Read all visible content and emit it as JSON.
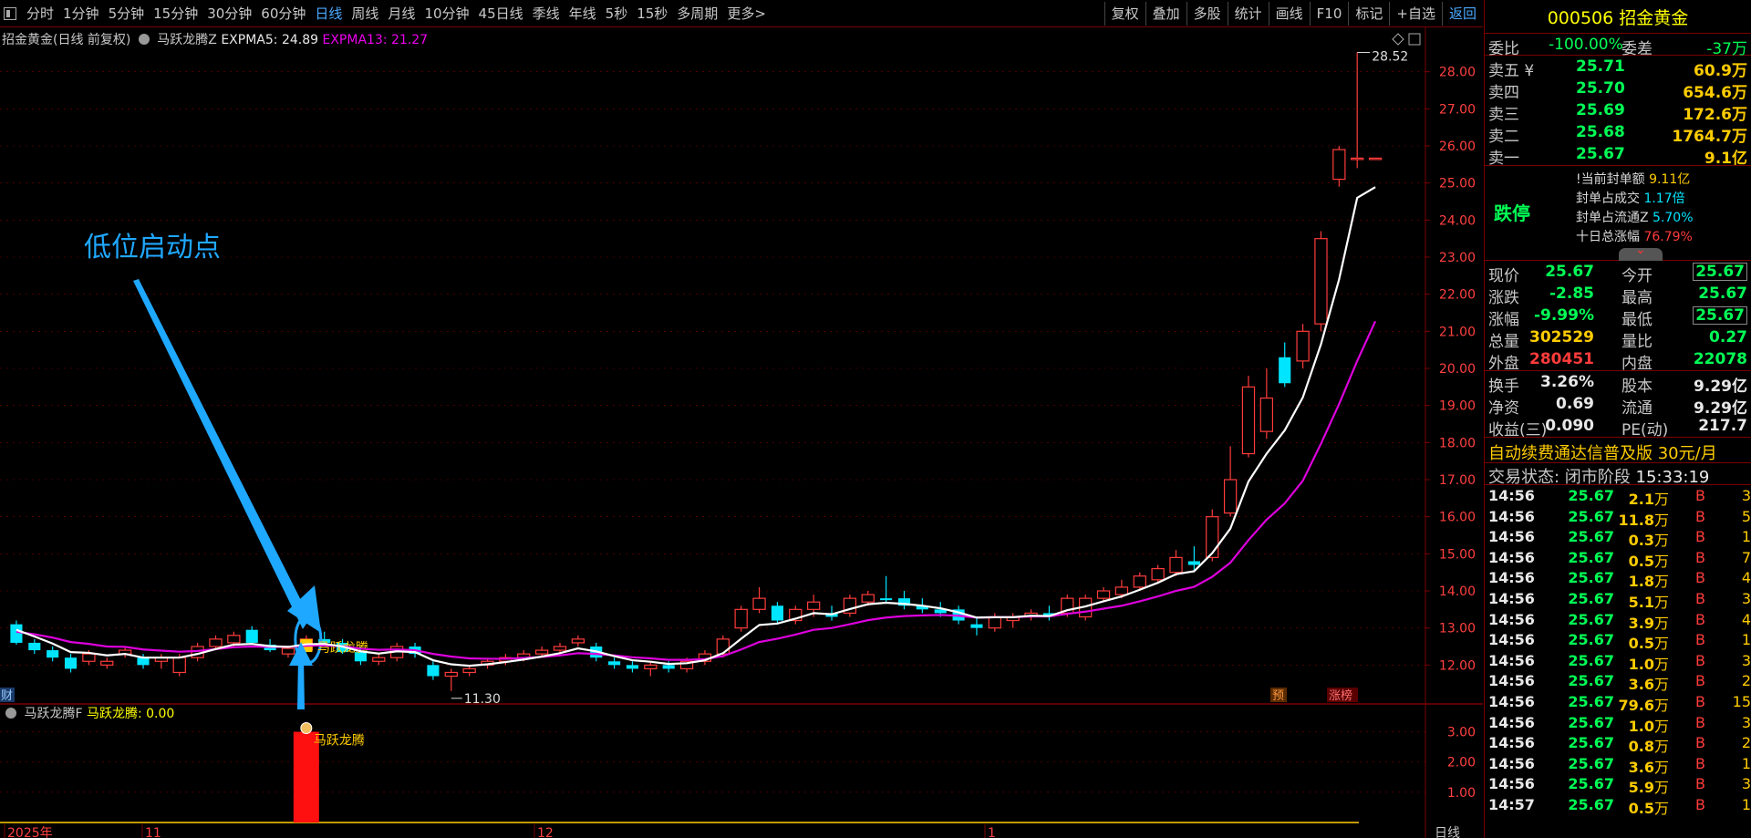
{
  "toolbar": {
    "periods": [
      "分时",
      "1分钟",
      "5分钟",
      "15分钟",
      "30分钟",
      "60分钟",
      "日线",
      "周线",
      "月线",
      "10分钟",
      "45日线",
      "季线",
      "年线",
      "5秒",
      "15秒",
      "多周期",
      "更多>"
    ],
    "active_period": "日线",
    "tools": [
      "复权",
      "叠加",
      "多股",
      "统计",
      "画线",
      "F10",
      "标记",
      "+自选",
      "返回"
    ]
  },
  "chart_header": {
    "stock": "招金黄金(日线 前复权)",
    "indicator": "马跃龙腾Z",
    "expma5": "EXPMA5: 24.89",
    "expma13": "EXPMA13: 21.27"
  },
  "annotation": "低位启动点",
  "chart_data": {
    "type": "candlestick",
    "y_ticks": [
      "28.00",
      "27.00",
      "26.00",
      "25.00",
      "24.00",
      "23.00",
      "22.00",
      "21.00",
      "20.00",
      "19.00",
      "18.00",
      "17.00",
      "16.00",
      "15.00",
      "14.00",
      "13.00",
      "12.00"
    ],
    "ylim": [
      11.0,
      29.0
    ],
    "high_label": "28.52",
    "low_label": "11.30",
    "signal_label": "马跃龙腾",
    "badges": [
      "预",
      "涨榜"
    ],
    "left_badge": "财",
    "x_labels": [
      "2025年",
      "11",
      "12",
      "1"
    ],
    "x_right_label": "日线",
    "ohlc": [
      [
        13.1,
        13.2,
        12.55,
        12.6
      ],
      [
        12.6,
        12.7,
        12.3,
        12.4
      ],
      [
        12.4,
        12.5,
        12.1,
        12.2
      ],
      [
        12.2,
        12.3,
        11.8,
        11.9
      ],
      [
        12.1,
        12.4,
        12.0,
        12.3
      ],
      [
        12.0,
        12.2,
        11.9,
        12.1
      ],
      [
        12.3,
        12.5,
        12.2,
        12.4
      ],
      [
        12.2,
        12.3,
        11.9,
        12.0
      ],
      [
        12.1,
        12.3,
        11.9,
        12.2
      ],
      [
        11.8,
        12.3,
        11.7,
        12.2
      ],
      [
        12.2,
        12.6,
        12.1,
        12.5
      ],
      [
        12.5,
        12.8,
        12.4,
        12.7
      ],
      [
        12.6,
        12.9,
        12.5,
        12.8
      ],
      [
        12.95,
        13.05,
        12.55,
        12.6
      ],
      [
        12.55,
        12.7,
        12.35,
        12.4
      ],
      [
        12.3,
        12.5,
        12.2,
        12.45
      ],
      [
        12.4,
        12.8,
        12.35,
        12.7
      ],
      [
        12.7,
        12.9,
        12.5,
        12.6
      ],
      [
        12.6,
        12.7,
        12.3,
        12.35
      ],
      [
        12.35,
        12.5,
        12.0,
        12.1
      ],
      [
        12.1,
        12.3,
        12.0,
        12.2
      ],
      [
        12.2,
        12.6,
        12.1,
        12.5
      ],
      [
        12.5,
        12.6,
        12.2,
        12.3
      ],
      [
        12.0,
        12.1,
        11.6,
        11.7
      ],
      [
        11.7,
        11.9,
        11.3,
        11.8
      ],
      [
        11.8,
        12.0,
        11.7,
        11.9
      ],
      [
        12.0,
        12.2,
        11.9,
        12.1
      ],
      [
        12.1,
        12.3,
        12.0,
        12.2
      ],
      [
        12.2,
        12.4,
        12.1,
        12.3
      ],
      [
        12.3,
        12.5,
        12.2,
        12.4
      ],
      [
        12.4,
        12.6,
        12.3,
        12.5
      ],
      [
        12.6,
        12.8,
        12.5,
        12.7
      ],
      [
        12.5,
        12.6,
        12.1,
        12.2
      ],
      [
        12.1,
        12.2,
        11.9,
        12.0
      ],
      [
        12.0,
        12.1,
        11.8,
        11.9
      ],
      [
        11.9,
        12.1,
        11.7,
        12.0
      ],
      [
        12.0,
        12.1,
        11.8,
        11.9
      ],
      [
        11.9,
        12.2,
        11.8,
        12.1
      ],
      [
        12.1,
        12.4,
        12.0,
        12.3
      ],
      [
        12.3,
        12.8,
        12.2,
        12.7
      ],
      [
        13.0,
        13.6,
        12.9,
        13.5
      ],
      [
        13.5,
        14.1,
        13.4,
        13.8
      ],
      [
        13.6,
        13.7,
        13.1,
        13.2
      ],
      [
        13.2,
        13.6,
        13.1,
        13.5
      ],
      [
        13.5,
        13.9,
        13.3,
        13.7
      ],
      [
        13.4,
        13.6,
        13.2,
        13.3
      ],
      [
        13.4,
        13.9,
        13.3,
        13.8
      ],
      [
        13.7,
        14.0,
        13.6,
        13.9
      ],
      [
        13.8,
        14.4,
        13.7,
        13.75
      ],
      [
        13.8,
        14.0,
        13.5,
        13.6
      ],
      [
        13.6,
        13.8,
        13.4,
        13.5
      ],
      [
        13.5,
        13.7,
        13.3,
        13.4
      ],
      [
        13.5,
        13.6,
        13.1,
        13.2
      ],
      [
        13.1,
        13.3,
        12.8,
        13.0
      ],
      [
        13.0,
        13.4,
        12.9,
        13.3
      ],
      [
        13.2,
        13.4,
        13.0,
        13.3
      ],
      [
        13.3,
        13.5,
        13.2,
        13.4
      ],
      [
        13.4,
        13.6,
        13.2,
        13.3
      ],
      [
        13.4,
        13.9,
        13.3,
        13.8
      ],
      [
        13.3,
        13.9,
        13.2,
        13.8
      ],
      [
        13.8,
        14.1,
        13.7,
        14.0
      ],
      [
        13.9,
        14.3,
        13.8,
        14.1
      ],
      [
        14.1,
        14.5,
        14.0,
        14.4
      ],
      [
        14.3,
        14.7,
        14.2,
        14.6
      ],
      [
        14.5,
        15.1,
        14.4,
        14.9
      ],
      [
        14.8,
        15.2,
        14.5,
        14.7
      ],
      [
        14.9,
        16.2,
        14.8,
        16.0
      ],
      [
        16.1,
        17.9,
        16.0,
        17.0
      ],
      [
        17.7,
        19.8,
        17.6,
        19.5
      ],
      [
        18.3,
        20.0,
        18.1,
        19.2
      ],
      [
        20.3,
        20.7,
        19.5,
        19.6
      ],
      [
        20.2,
        21.2,
        20.0,
        21.0
      ],
      [
        21.2,
        23.7,
        21.0,
        23.5
      ],
      [
        25.1,
        26.0,
        24.9,
        25.9
      ],
      [
        25.67,
        28.52,
        25.4,
        25.67
      ],
      [
        25.67,
        25.67,
        25.67,
        25.67
      ]
    ],
    "expma5": [
      12.95,
      12.77,
      12.58,
      12.35,
      12.33,
      12.26,
      12.3,
      12.2,
      12.2,
      12.2,
      12.3,
      12.43,
      12.55,
      12.57,
      12.51,
      12.49,
      12.56,
      12.57,
      12.5,
      12.37,
      12.31,
      12.37,
      12.35,
      12.13,
      12.02,
      11.98,
      12.02,
      12.08,
      12.15,
      12.23,
      12.32,
      12.45,
      12.37,
      12.24,
      12.13,
      12.09,
      12.03,
      12.05,
      12.13,
      12.32,
      12.71,
      13.08,
      13.12,
      13.25,
      13.4,
      13.37,
      13.51,
      13.64,
      13.68,
      13.65,
      13.6,
      13.53,
      13.42,
      13.28,
      13.29,
      13.29,
      13.33,
      13.32,
      13.48,
      13.58,
      13.72,
      13.85,
      14.03,
      14.22,
      14.45,
      14.53,
      15.02,
      15.68,
      16.95,
      17.7,
      18.33,
      19.22,
      20.65,
      22.4,
      24.6,
      24.89
    ],
    "expma13": [
      12.9,
      12.83,
      12.74,
      12.62,
      12.57,
      12.5,
      12.49,
      12.42,
      12.39,
      12.36,
      12.38,
      12.43,
      12.48,
      12.5,
      12.49,
      12.49,
      12.52,
      12.53,
      12.51,
      12.44,
      12.41,
      12.42,
      12.4,
      12.3,
      12.23,
      12.18,
      12.17,
      12.17,
      12.19,
      12.22,
      12.26,
      12.32,
      12.3,
      12.26,
      12.21,
      12.18,
      12.14,
      12.14,
      12.16,
      12.24,
      12.42,
      12.62,
      12.71,
      12.82,
      12.95,
      13.0,
      13.1,
      13.21,
      13.28,
      13.32,
      13.34,
      13.35,
      13.33,
      13.28,
      13.29,
      13.29,
      13.31,
      13.31,
      13.38,
      13.44,
      13.52,
      13.6,
      13.72,
      13.85,
      14.0,
      14.11,
      14.38,
      14.76,
      15.37,
      15.92,
      16.36,
      16.97,
      17.97,
      19.04,
      20.2,
      21.27
    ],
    "signal_index": 16,
    "sub_ticks": [
      "3.00",
      "2.00",
      "1.00"
    ],
    "sub_ylim": [
      0,
      3.8
    ],
    "sub_value": 3.0
  },
  "sub_header": {
    "name": "马跃龙腾F",
    "value": "马跃龙腾: 0.00"
  },
  "panel": {
    "code_name": "000506 招金黄金",
    "weibi": {
      "label": "委比",
      "value": "-100.00%",
      "label2": "委差",
      "value2": "-37万"
    },
    "asks": [
      {
        "label": "卖五 ¥",
        "price": "25.71",
        "vol": "60.9万"
      },
      {
        "label": "卖四",
        "price": "25.70",
        "vol": "654.6万"
      },
      {
        "label": "卖三",
        "price": "25.69",
        "vol": "172.6万"
      },
      {
        "label": "卖二",
        "price": "25.68",
        "vol": "1764.7万"
      },
      {
        "label": "卖一",
        "price": "25.67",
        "vol": "9.1亿"
      }
    ],
    "limit_down": "跌停",
    "seal": [
      {
        "k": "!当前封单额",
        "v": "9.11亿"
      },
      {
        "k": "封单占成交",
        "v": "1.17倍"
      },
      {
        "k": "封单占流通Z",
        "v": "5.70%"
      },
      {
        "k": "十日总涨幅",
        "v": "76.79%"
      }
    ],
    "quotes": [
      {
        "l1": "现价",
        "v1": "25.67",
        "l2": "今开",
        "v2": "25.67"
      },
      {
        "l1": "涨跌",
        "v1": "-2.85",
        "l2": "最高",
        "v2": "25.67"
      },
      {
        "l1": "涨幅",
        "v1": "-9.99%",
        "l2": "最低",
        "v2": "25.67"
      },
      {
        "l1": "总量",
        "v1": "302529",
        "l2": "量比",
        "v2": "0.27"
      },
      {
        "l1": "外盘",
        "v1": "280451",
        "l2": "内盘",
        "v2": "22078"
      }
    ],
    "stats": [
      {
        "l1": "换手",
        "v1": "3.26%",
        "l2": "股本",
        "v2": "9.29亿"
      },
      {
        "l1": "净资",
        "v1": "0.69",
        "l2": "流通",
        "v2": "9.29亿"
      },
      {
        "l1": "收益(三)",
        "v1": "0.090",
        "l2": "PE(动)",
        "v2": "217.7"
      }
    ],
    "promo": "自动续费通达信普及版  30元/月",
    "trade_status_label": "交易状态: 闭市阶段",
    "trade_status_time": "15:33:19",
    "ticks": [
      {
        "t": "14:56",
        "p": "25.67",
        "v": "2.1",
        "u": "万",
        "b": "B",
        "n": "3"
      },
      {
        "t": "14:56",
        "p": "25.67",
        "v": "11.8",
        "u": "万",
        "b": "B",
        "n": "5"
      },
      {
        "t": "14:56",
        "p": "25.67",
        "v": "0.3",
        "u": "万",
        "b": "B",
        "n": "1"
      },
      {
        "t": "14:56",
        "p": "25.67",
        "v": "0.5",
        "u": "万",
        "b": "B",
        "n": "7"
      },
      {
        "t": "14:56",
        "p": "25.67",
        "v": "1.8",
        "u": "万",
        "b": "B",
        "n": "4"
      },
      {
        "t": "14:56",
        "p": "25.67",
        "v": "5.1",
        "u": "万",
        "b": "B",
        "n": "3"
      },
      {
        "t": "14:56",
        "p": "25.67",
        "v": "3.9",
        "u": "万",
        "b": "B",
        "n": "4"
      },
      {
        "t": "14:56",
        "p": "25.67",
        "v": "0.5",
        "u": "万",
        "b": "B",
        "n": "1"
      },
      {
        "t": "14:56",
        "p": "25.67",
        "v": "1.0",
        "u": "万",
        "b": "B",
        "n": "3"
      },
      {
        "t": "14:56",
        "p": "25.67",
        "v": "3.6",
        "u": "万",
        "b": "B",
        "n": "2"
      },
      {
        "t": "14:56",
        "p": "25.67",
        "v": "79.6",
        "u": "万",
        "b": "B",
        "n": "15"
      },
      {
        "t": "14:56",
        "p": "25.67",
        "v": "1.0",
        "u": "万",
        "b": "B",
        "n": "3"
      },
      {
        "t": "14:56",
        "p": "25.67",
        "v": "0.8",
        "u": "万",
        "b": "B",
        "n": "2"
      },
      {
        "t": "14:56",
        "p": "25.67",
        "v": "3.6",
        "u": "万",
        "b": "B",
        "n": "1"
      },
      {
        "t": "14:56",
        "p": "25.67",
        "v": "5.9",
        "u": "万",
        "b": "B",
        "n": "3"
      },
      {
        "t": "14:57",
        "p": "25.67",
        "v": "0.5",
        "u": "万",
        "b": "B",
        "n": "1"
      }
    ],
    "colors": {
      "up": "#ff3b3b",
      "down": "#00e5ff",
      "expma5": "#ffffff",
      "expma13": "#dd00dd",
      "grid": "#7a0000",
      "signal": "#ffcc00"
    }
  }
}
